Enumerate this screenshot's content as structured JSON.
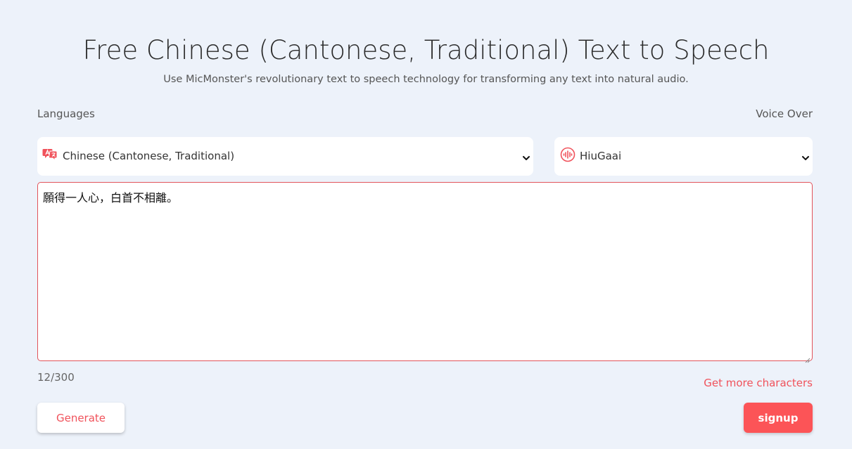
{
  "header": {
    "title": "Free Chinese (Cantonese, Traditional) Text to Speech",
    "subtitle": "Use MicMonster's revolutionary text to speech technology for transforming any text into natural audio."
  },
  "form": {
    "languages_label": "Languages",
    "voice_label": "Voice Over",
    "language_value": "Chinese (Cantonese, Traditional)",
    "voice_value": "HiuGaai",
    "text_value": "願得一人心，白首不相離。",
    "char_count": "12/300",
    "more_characters_link": "Get more characters"
  },
  "buttons": {
    "generate_label": "Generate",
    "signup_label": "signup"
  },
  "icons": {
    "language": "translate-icon",
    "voice": "audio-wave-icon",
    "chevron": "chevron-down-icon"
  },
  "colors": {
    "accent": "#fc5457",
    "background": "#edf2fa"
  }
}
